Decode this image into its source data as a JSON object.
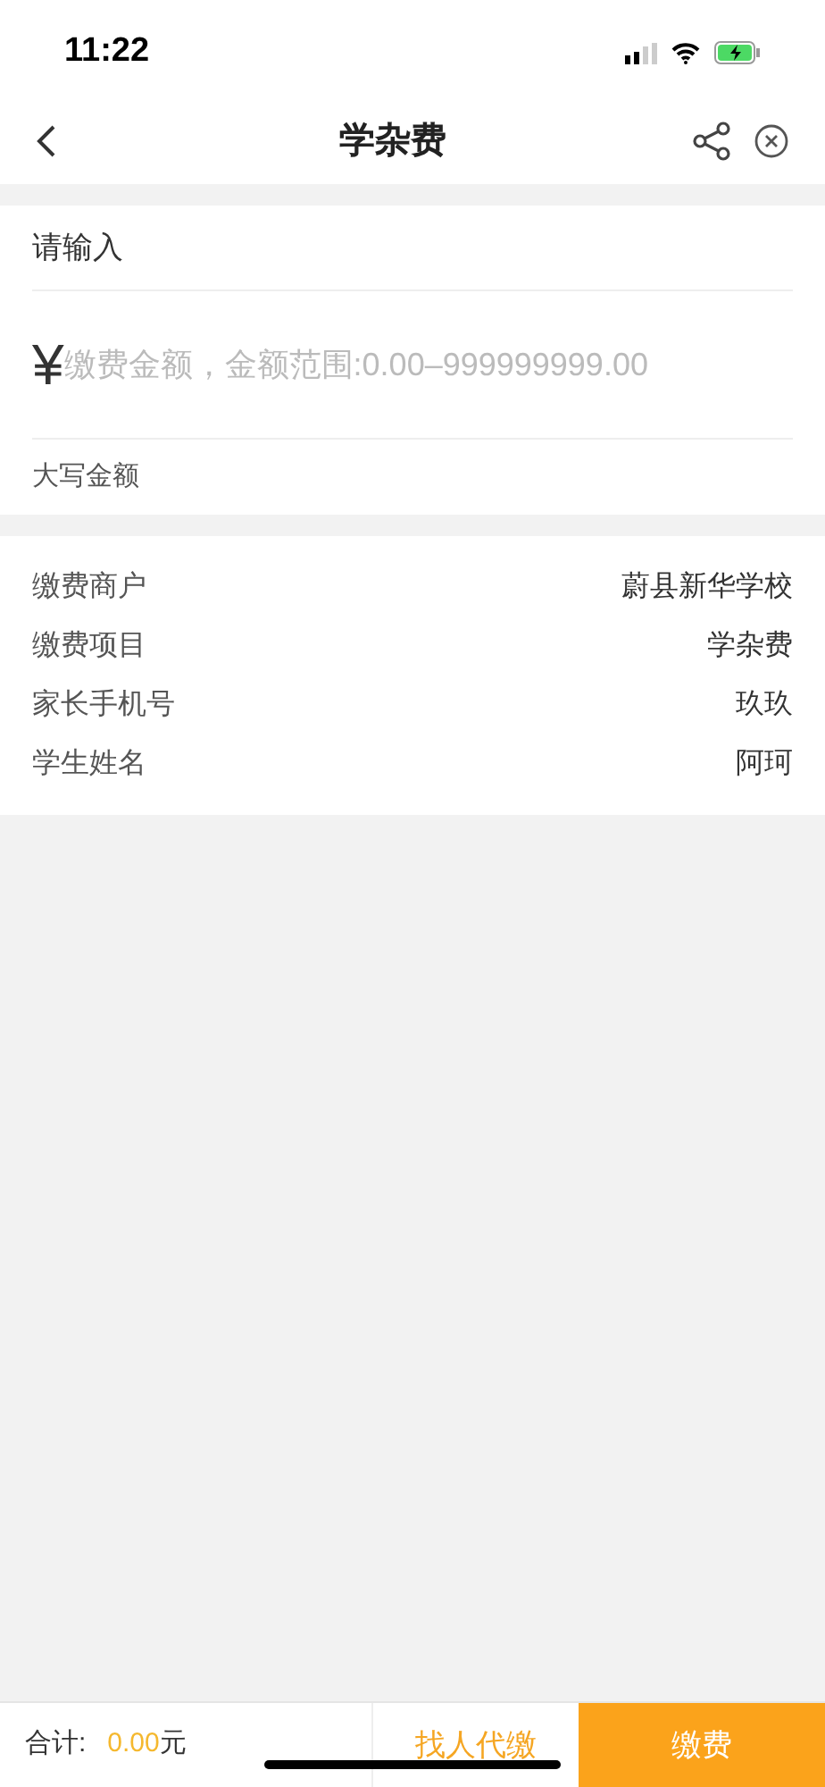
{
  "status_bar": {
    "time": "11:22"
  },
  "nav": {
    "title": "学杂费"
  },
  "amount": {
    "label": "请输入",
    "currency": "¥",
    "placeholder": "缴费金额，金额范围:0.00–999999999.00",
    "uppercase_label": "大写金额"
  },
  "details": [
    {
      "label": "缴费商户",
      "value": "蔚县新华学校"
    },
    {
      "label": "缴费项目",
      "value": "学杂费"
    },
    {
      "label": "家长手机号",
      "value": "玖玖"
    },
    {
      "label": "学生姓名",
      "value": "阿珂"
    }
  ],
  "footer": {
    "total_label": "合计:",
    "total_value": "0.00",
    "unit": "元",
    "proxy_button": "找人代缴",
    "pay_button": "缴费"
  }
}
